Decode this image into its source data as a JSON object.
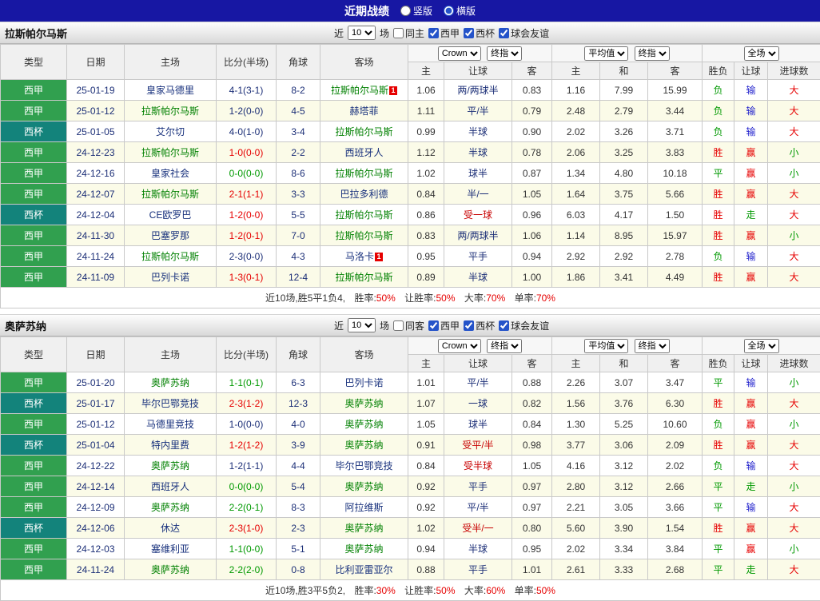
{
  "topbar": {
    "title": "近期战绩",
    "vertical_label": "竖版",
    "vertical_checked": false,
    "horizontal_label": "横版",
    "horizontal_checked": true
  },
  "columns": {
    "type": "类型",
    "date": "日期",
    "home": "主场",
    "score": "比分(半场)",
    "corner": "角球",
    "away": "客场",
    "asia_home": "主",
    "asia_line": "让球",
    "asia_away": "客",
    "euro_home": "主",
    "euro_draw": "和",
    "euro_away": "客",
    "result": "胜负",
    "handicap_result": "让球",
    "goals": "进球数"
  },
  "colors": {
    "league_liga": "#31a04f",
    "league_cup": "#13837b",
    "win": "#e60000",
    "draw_loss": "#009900",
    "handicap_lose": "#2222cc",
    "focal_team": "#008000",
    "topbar_bg": "#1717a3"
  },
  "sections": [
    {
      "team": "拉斯帕尔马斯",
      "filters": {
        "near_label": "近",
        "count": "10",
        "games_label": "场",
        "same_label": "同主",
        "same_checked": false,
        "leagues": [
          {
            "label": "西甲",
            "checked": true
          },
          {
            "label": "西杯",
            "checked": true
          },
          {
            "label": "球会友谊",
            "checked": true
          }
        ]
      },
      "selects": {
        "bookmaker": "Crown",
        "asia_final": "终指",
        "europe_avg": "平均值",
        "europe_final": "终指",
        "scope": "全场"
      },
      "rows": [
        {
          "lg": "西甲",
          "date": "25-01-19",
          "home": "皇家马德里",
          "hc": 0,
          "score": "4-1(3-1)",
          "corner": "8-2",
          "away": "拉斯帕尔马斯",
          "ac": 1,
          "asia": [
            "1.06",
            "两/两球半",
            "0.83"
          ],
          "euro": [
            "1.16",
            "7.99",
            "15.99"
          ],
          "res": "负",
          "hcp": "输",
          "goal": "大"
        },
        {
          "lg": "西甲",
          "date": "25-01-12",
          "home": "拉斯帕尔马斯",
          "hc": 0,
          "score": "1-2(0-0)",
          "corner": "4-5",
          "away": "赫塔菲",
          "ac": 0,
          "asia": [
            "1.11",
            "平/半",
            "0.79"
          ],
          "euro": [
            "2.48",
            "2.79",
            "3.44"
          ],
          "res": "负",
          "hcp": "输",
          "goal": "大"
        },
        {
          "lg": "西杯",
          "date": "25-01-05",
          "home": "艾尔切",
          "hc": 0,
          "score": "4-0(1-0)",
          "corner": "3-4",
          "away": "拉斯帕尔马斯",
          "ac": 0,
          "asia": [
            "0.99",
            "半球",
            "0.90"
          ],
          "euro": [
            "2.02",
            "3.26",
            "3.71"
          ],
          "res": "负",
          "hcp": "输",
          "goal": "大"
        },
        {
          "lg": "西甲",
          "date": "24-12-23",
          "home": "拉斯帕尔马斯",
          "hc": 0,
          "score": "1-0(0-0)",
          "corner": "2-2",
          "away": "西班牙人",
          "ac": 0,
          "asia": [
            "1.12",
            "半球",
            "0.78"
          ],
          "euro": [
            "2.06",
            "3.25",
            "3.83"
          ],
          "res": "胜",
          "hcp": "赢",
          "goal": "小"
        },
        {
          "lg": "西甲",
          "date": "24-12-16",
          "home": "皇家社会",
          "hc": 0,
          "score": "0-0(0-0)",
          "corner": "8-6",
          "away": "拉斯帕尔马斯",
          "ac": 0,
          "asia": [
            "1.02",
            "球半",
            "0.87"
          ],
          "euro": [
            "1.34",
            "4.80",
            "10.18"
          ],
          "res": "平",
          "hcp": "赢",
          "goal": "小"
        },
        {
          "lg": "西甲",
          "date": "24-12-07",
          "home": "拉斯帕尔马斯",
          "hc": 0,
          "score": "2-1(1-1)",
          "corner": "3-3",
          "away": "巴拉多利德",
          "ac": 0,
          "asia": [
            "0.84",
            "半/一",
            "1.05"
          ],
          "euro": [
            "1.64",
            "3.75",
            "5.66"
          ],
          "res": "胜",
          "hcp": "赢",
          "goal": "大"
        },
        {
          "lg": "西杯",
          "date": "24-12-04",
          "home": "CE欧罗巴",
          "hc": 0,
          "score": "1-2(0-0)",
          "corner": "5-5",
          "away": "拉斯帕尔马斯",
          "ac": 0,
          "asia": [
            "0.86",
            "受一球",
            "0.96"
          ],
          "euro": [
            "6.03",
            "4.17",
            "1.50"
          ],
          "res": "胜",
          "hcp": "走",
          "goal": "大"
        },
        {
          "lg": "西甲",
          "date": "24-11-30",
          "home": "巴塞罗那",
          "hc": 0,
          "score": "1-2(0-1)",
          "corner": "7-0",
          "away": "拉斯帕尔马斯",
          "ac": 0,
          "asia": [
            "0.83",
            "两/两球半",
            "1.06"
          ],
          "euro": [
            "1.14",
            "8.95",
            "15.97"
          ],
          "res": "胜",
          "hcp": "赢",
          "goal": "小"
        },
        {
          "lg": "西甲",
          "date": "24-11-24",
          "home": "拉斯帕尔马斯",
          "hc": 0,
          "score": "2-3(0-0)",
          "corner": "4-3",
          "away": "马洛卡",
          "ac": 1,
          "asia": [
            "0.95",
            "平手",
            "0.94"
          ],
          "euro": [
            "2.92",
            "2.92",
            "2.78"
          ],
          "res": "负",
          "hcp": "输",
          "goal": "大"
        },
        {
          "lg": "西甲",
          "date": "24-11-09",
          "home": "巴列卡诺",
          "hc": 0,
          "score": "1-3(0-1)",
          "corner": "12-4",
          "away": "拉斯帕尔马斯",
          "ac": 0,
          "asia": [
            "0.89",
            "半球",
            "1.00"
          ],
          "euro": [
            "1.86",
            "3.41",
            "4.49"
          ],
          "res": "胜",
          "hcp": "赢",
          "goal": "大"
        }
      ],
      "summary": {
        "prefix": "近10场,胜5平1负4,",
        "win_label": "胜率:",
        "win_pct": "50%",
        "handicap_label": "让胜率:",
        "handicap_pct": "50%",
        "big_label": "大率:",
        "big_pct": "70%",
        "odd_label": "单率:",
        "odd_pct": "70%"
      }
    },
    {
      "team": "奥萨苏纳",
      "filters": {
        "near_label": "近",
        "count": "10",
        "games_label": "场",
        "same_label": "同客",
        "same_checked": false,
        "leagues": [
          {
            "label": "西甲",
            "checked": true
          },
          {
            "label": "西杯",
            "checked": true
          },
          {
            "label": "球会友谊",
            "checked": true
          }
        ]
      },
      "selects": {
        "bookmaker": "Crown",
        "asia_final": "终指",
        "europe_avg": "平均值",
        "europe_final": "终指",
        "scope": "全场"
      },
      "rows": [
        {
          "lg": "西甲",
          "date": "25-01-20",
          "home": "奥萨苏纳",
          "hc": 0,
          "score": "1-1(0-1)",
          "corner": "6-3",
          "away": "巴列卡诺",
          "ac": 0,
          "asia": [
            "1.01",
            "平/半",
            "0.88"
          ],
          "euro": [
            "2.26",
            "3.07",
            "3.47"
          ],
          "res": "平",
          "hcp": "输",
          "goal": "小"
        },
        {
          "lg": "西杯",
          "date": "25-01-17",
          "home": "毕尔巴鄂竞技",
          "hc": 0,
          "score": "2-3(1-2)",
          "corner": "12-3",
          "away": "奥萨苏纳",
          "ac": 0,
          "asia": [
            "1.07",
            "一球",
            "0.82"
          ],
          "euro": [
            "1.56",
            "3.76",
            "6.30"
          ],
          "res": "胜",
          "hcp": "赢",
          "goal": "大"
        },
        {
          "lg": "西甲",
          "date": "25-01-12",
          "home": "马德里竞技",
          "hc": 0,
          "score": "1-0(0-0)",
          "corner": "4-0",
          "away": "奥萨苏纳",
          "ac": 0,
          "asia": [
            "1.05",
            "球半",
            "0.84"
          ],
          "euro": [
            "1.30",
            "5.25",
            "10.60"
          ],
          "res": "负",
          "hcp": "赢",
          "goal": "小"
        },
        {
          "lg": "西杯",
          "date": "25-01-04",
          "home": "特内里费",
          "hc": 0,
          "score": "1-2(1-2)",
          "corner": "3-9",
          "away": "奥萨苏纳",
          "ac": 0,
          "asia": [
            "0.91",
            "受平/半",
            "0.98"
          ],
          "euro": [
            "3.77",
            "3.06",
            "2.09"
          ],
          "res": "胜",
          "hcp": "赢",
          "goal": "大"
        },
        {
          "lg": "西甲",
          "date": "24-12-22",
          "home": "奥萨苏纳",
          "hc": 0,
          "score": "1-2(1-1)",
          "corner": "4-4",
          "away": "毕尔巴鄂竞技",
          "ac": 0,
          "asia": [
            "0.84",
            "受半球",
            "1.05"
          ],
          "euro": [
            "4.16",
            "3.12",
            "2.02"
          ],
          "res": "负",
          "hcp": "输",
          "goal": "大"
        },
        {
          "lg": "西甲",
          "date": "24-12-14",
          "home": "西班牙人",
          "hc": 0,
          "score": "0-0(0-0)",
          "corner": "5-4",
          "away": "奥萨苏纳",
          "ac": 0,
          "asia": [
            "0.92",
            "平手",
            "0.97"
          ],
          "euro": [
            "2.80",
            "3.12",
            "2.66"
          ],
          "res": "平",
          "hcp": "走",
          "goal": "小"
        },
        {
          "lg": "西甲",
          "date": "24-12-09",
          "home": "奥萨苏纳",
          "hc": 0,
          "score": "2-2(0-1)",
          "corner": "8-3",
          "away": "阿拉维斯",
          "ac": 0,
          "asia": [
            "0.92",
            "平/半",
            "0.97"
          ],
          "euro": [
            "2.21",
            "3.05",
            "3.66"
          ],
          "res": "平",
          "hcp": "输",
          "goal": "大"
        },
        {
          "lg": "西杯",
          "date": "24-12-06",
          "home": "休达",
          "hc": 0,
          "score": "2-3(1-0)",
          "corner": "2-3",
          "away": "奥萨苏纳",
          "ac": 0,
          "asia": [
            "1.02",
            "受半/一",
            "0.80"
          ],
          "euro": [
            "5.60",
            "3.90",
            "1.54"
          ],
          "res": "胜",
          "hcp": "赢",
          "goal": "大"
        },
        {
          "lg": "西甲",
          "date": "24-12-03",
          "home": "塞维利亚",
          "hc": 0,
          "score": "1-1(0-0)",
          "corner": "5-1",
          "away": "奥萨苏纳",
          "ac": 0,
          "asia": [
            "0.94",
            "半球",
            "0.95"
          ],
          "euro": [
            "2.02",
            "3.34",
            "3.84"
          ],
          "res": "平",
          "hcp": "赢",
          "goal": "小"
        },
        {
          "lg": "西甲",
          "date": "24-11-24",
          "home": "奥萨苏纳",
          "hc": 0,
          "score": "2-2(2-0)",
          "corner": "0-8",
          "away": "比利亚雷亚尔",
          "ac": 0,
          "asia": [
            "0.88",
            "平手",
            "1.01"
          ],
          "euro": [
            "2.61",
            "3.33",
            "2.68"
          ],
          "res": "平",
          "hcp": "走",
          "goal": "大"
        }
      ],
      "summary": {
        "prefix": "近10场,胜3平5负2,",
        "win_label": "胜率:",
        "win_pct": "30%",
        "handicap_label": "让胜率:",
        "handicap_pct": "50%",
        "big_label": "大率:",
        "big_pct": "60%",
        "odd_label": "单率:",
        "odd_pct": "50%"
      }
    }
  ]
}
